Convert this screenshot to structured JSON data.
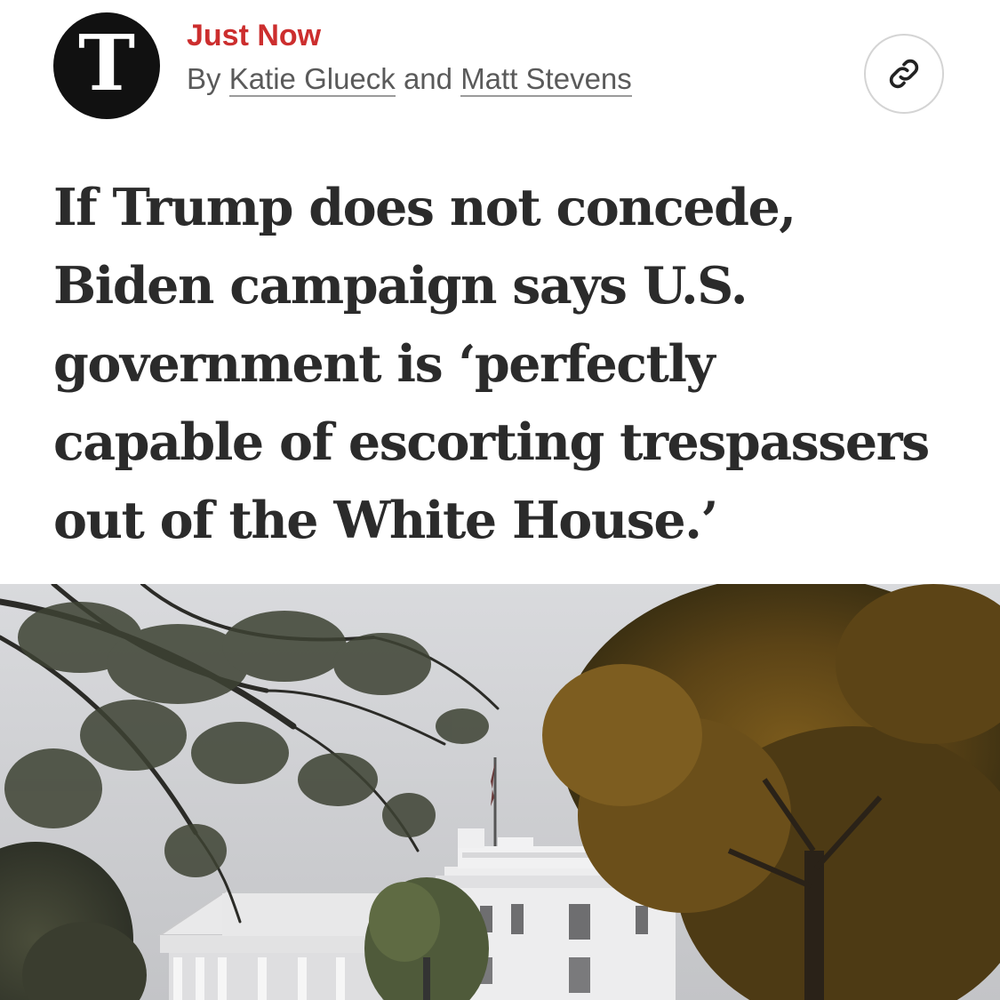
{
  "logo": {
    "glyph": "T",
    "icon": "nyt-logo-icon"
  },
  "article": {
    "kicker": "Just Now",
    "byline_prefix": "By",
    "authors": [
      "Katie Glueck",
      "Matt Stevens"
    ],
    "author_joiner": "and",
    "headline_lines": [
      "If Trump does not concede,",
      "Biden campaign says U.S.",
      "government is ‘perfectly",
      "capable of escorting trespassers",
      "out of the White House.’"
    ]
  },
  "actions": {
    "share_link_icon": "link-icon"
  },
  "photo": {
    "subject": "white-house-photo"
  },
  "colors": {
    "kicker": "#cc2e2e",
    "headline": "#2b2b2b",
    "byline": "#5a5a5a",
    "logo_bg": "#111111"
  }
}
